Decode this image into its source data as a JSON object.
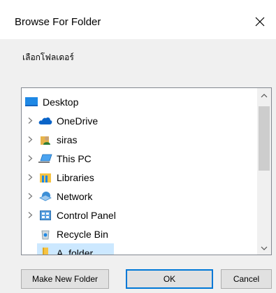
{
  "dialog": {
    "title": "Browse For Folder",
    "instruction": "เลือกโฟลเดอร์"
  },
  "tree": {
    "root": {
      "label": "Desktop",
      "icon": "desktop-icon"
    },
    "items": [
      {
        "label": "OneDrive",
        "icon": "onedrive-cloud-icon",
        "expandable": true
      },
      {
        "label": "siras",
        "icon": "user-folder-icon",
        "expandable": true
      },
      {
        "label": "This PC",
        "icon": "this-pc-icon",
        "expandable": true
      },
      {
        "label": "Libraries",
        "icon": "libraries-icon",
        "expandable": true
      },
      {
        "label": "Network",
        "icon": "network-icon",
        "expandable": true
      },
      {
        "label": "Control Panel",
        "icon": "control-panel-icon",
        "expandable": true
      },
      {
        "label": "Recycle Bin",
        "icon": "recycle-bin-icon",
        "expandable": false
      },
      {
        "label": "A_folder",
        "icon": "folder-icon",
        "expandable": false,
        "selected": true
      }
    ]
  },
  "buttons": {
    "make_new_folder": "Make New Folder",
    "ok": "OK",
    "cancel": "Cancel"
  },
  "colors": {
    "selection": "#cce8ff",
    "ok_border": "#0078d7",
    "dialog_bg": "#f0f0f0"
  }
}
